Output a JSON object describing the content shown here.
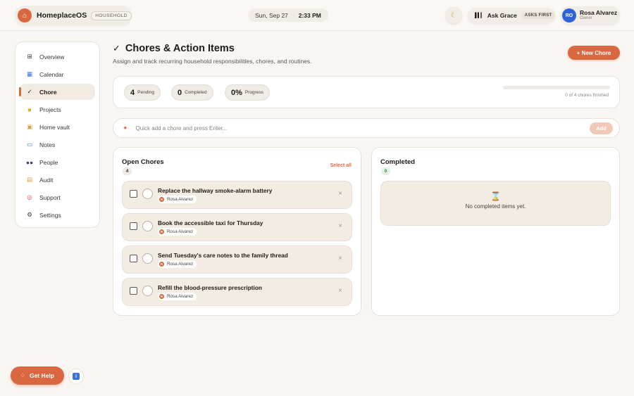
{
  "header": {
    "brand_name": "HomeplaceOS",
    "brand_tag": "HOUSEHOLD",
    "date": "Sun, Sep 27",
    "time": "2:33 PM",
    "ask_label": "Ask Grace",
    "ask_tag": "ASKS FIRST",
    "user_initials": "RO",
    "user_name": "Rosa Alvarez",
    "user_role": "Owner"
  },
  "sidebar": {
    "items": [
      {
        "label": "Overview",
        "icon": "grid-icon"
      },
      {
        "label": "Calendar",
        "icon": "calendar-icon"
      },
      {
        "label": "Chore",
        "icon": "check-icon",
        "active": true
      },
      {
        "label": "Projects",
        "icon": "folder-icon"
      },
      {
        "label": "Home vault",
        "icon": "lock-icon"
      },
      {
        "label": "Notes",
        "icon": "book-icon"
      },
      {
        "label": "People",
        "icon": "people-icon"
      },
      {
        "label": "Audit",
        "icon": "scroll-icon"
      },
      {
        "label": "Support",
        "icon": "lifebuoy-icon"
      },
      {
        "label": "Settings",
        "icon": "gear-icon"
      }
    ]
  },
  "page": {
    "title": "Chores & Action Items",
    "subtitle": "Assign and track recurring household responsibilities, chores, and routines.",
    "new_button": "+ New Chore"
  },
  "stats": {
    "pending_value": "4",
    "pending_label": "Pending",
    "completed_value": "0",
    "completed_label": "Completed",
    "progress_value": "0%",
    "progress_label": "Progress",
    "progress_fraction": 0,
    "progress_text": "0 of 4 chores finished"
  },
  "quick_add": {
    "placeholder": "Quick add a chore and press Enter...",
    "button": "Add"
  },
  "open_panel": {
    "title": "Open Chores",
    "count": "4",
    "select_all": "Select all",
    "items": [
      {
        "title": "Replace the hallway smoke-alarm battery",
        "owner": "Rosa Alvarez"
      },
      {
        "title": "Book the accessible taxi for Thursday",
        "owner": "Rosa Alvarez"
      },
      {
        "title": "Send Tuesday's care notes to the family thread",
        "owner": "Rosa Alvarez"
      },
      {
        "title": "Refill the blood-pressure prescription",
        "owner": "Rosa Alvarez"
      }
    ]
  },
  "done_panel": {
    "title": "Completed",
    "count": "0",
    "empty_text": "No completed items yet."
  },
  "footer": {
    "help_label": "Get Help",
    "info_glyph": "i"
  },
  "colors": {
    "accent": "#d9673f",
    "background": "#f8f6f3",
    "card": "#f3ece3"
  }
}
